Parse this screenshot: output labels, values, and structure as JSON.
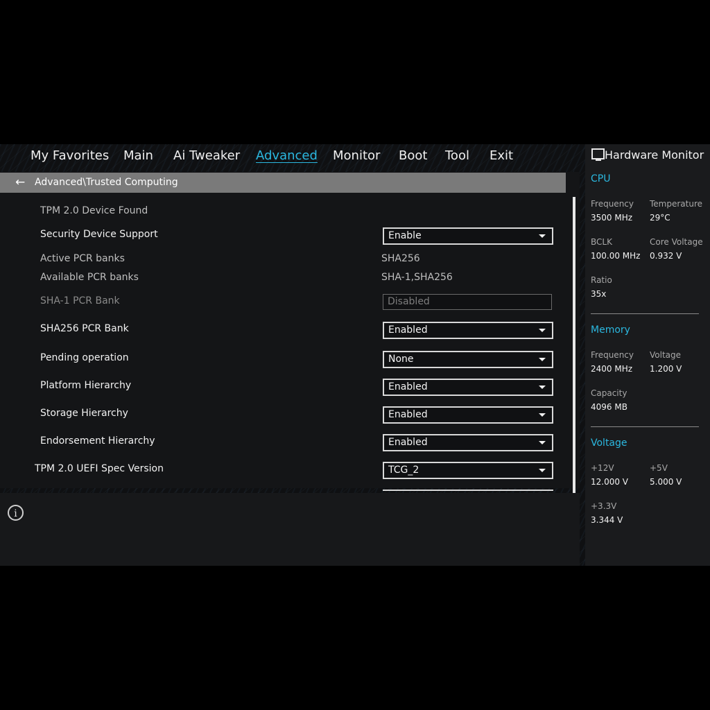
{
  "nav": {
    "tabs": [
      "My Favorites",
      "Main",
      "Ai Tweaker",
      "Advanced",
      "Monitor",
      "Boot",
      "Tool",
      "Exit"
    ],
    "active": "Advanced"
  },
  "breadcrumb": {
    "path": "Advanced\\Trusted Computing"
  },
  "settings": {
    "tpm_found": "TPM 2.0 Device Found",
    "security_device_support": {
      "label": "Security Device Support",
      "value": "Enable"
    },
    "active_pcr_banks": {
      "label": "Active PCR banks",
      "value": "SHA256"
    },
    "available_pcr_banks": {
      "label": "Available PCR banks",
      "value": "SHA-1,SHA256"
    },
    "sha1_pcr_bank": {
      "label": "SHA-1 PCR Bank",
      "value": "Disabled"
    },
    "sha256_pcr_bank": {
      "label": "SHA256 PCR Bank",
      "value": "Enabled"
    },
    "pending_operation": {
      "label": "Pending operation",
      "value": "None"
    },
    "platform_hierarchy": {
      "label": "Platform Hierarchy",
      "value": "Enabled"
    },
    "storage_hierarchy": {
      "label": "Storage Hierarchy",
      "value": "Enabled"
    },
    "endorsement_hierarchy": {
      "label": "Endorsement Hierarchy",
      "value": "Enabled"
    },
    "uefi_spec_version": {
      "label": "TPM 2.0 UEFI Spec Version",
      "value": "TCG_2"
    }
  },
  "info": {
    "icon": "info-icon"
  },
  "hardware_monitor": {
    "title": "Hardware Monitor",
    "cpu": {
      "section": "CPU",
      "frequency_label": "Frequency",
      "frequency": "3500 MHz",
      "temperature_label": "Temperature",
      "temperature": "29°C",
      "bclk_label": "BCLK",
      "bclk": "100.00 MHz",
      "core_voltage_label": "Core Voltage",
      "core_voltage": "0.932 V",
      "ratio_label": "Ratio",
      "ratio": "35x"
    },
    "memory": {
      "section": "Memory",
      "frequency_label": "Frequency",
      "frequency": "2400 MHz",
      "voltage_label": "Voltage",
      "voltage": "1.200 V",
      "capacity_label": "Capacity",
      "capacity": "4096 MB"
    },
    "voltage": {
      "section": "Voltage",
      "v12_label": "+12V",
      "v12": "12.000 V",
      "v5_label": "+5V",
      "v5": "5.000 V",
      "v33_label": "+3.3V",
      "v33": "3.344 V"
    }
  },
  "colors": {
    "accent": "#2bb8e0",
    "breadcrumb_bg": "#7a7a7a",
    "panel_bg": "#141517"
  }
}
